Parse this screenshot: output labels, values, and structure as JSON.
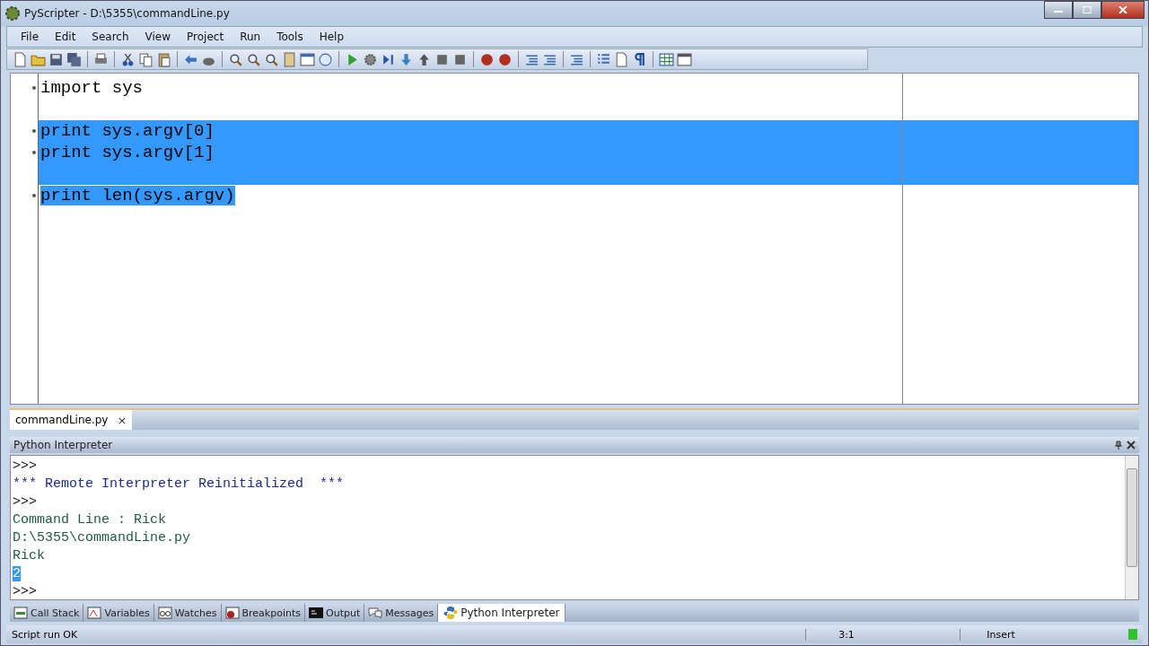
{
  "window": {
    "title": "PyScripter - D:\\5355\\commandLine.py"
  },
  "menu": [
    "File",
    "Edit",
    "Search",
    "View",
    "Project",
    "Run",
    "Tools",
    "Help"
  ],
  "editor": {
    "lines": [
      {
        "kind": "code",
        "text": "import sys",
        "selected": false
      },
      {
        "kind": "blank"
      },
      {
        "kind": "code",
        "text": "print sys.argv[0]",
        "selected": true
      },
      {
        "kind": "code",
        "text": "print sys.argv[1]",
        "selected": true
      },
      {
        "kind": "blank",
        "selected": true
      },
      {
        "kind": "code",
        "text": "print len(sys.argv)",
        "selected": true
      }
    ]
  },
  "editor_tabs": [
    {
      "label": "commandLine.py",
      "close": "×",
      "selected": true
    }
  ],
  "interpreter": {
    "title": "Python Interpreter",
    "lines": [
      {
        "kind": "prompt",
        "text": ">>>",
        "selected": false
      },
      {
        "kind": "info",
        "text": "*** Remote Interpreter Reinitialized  ***",
        "selected": false
      },
      {
        "kind": "prompt",
        "text": ">>>",
        "selected": false
      },
      {
        "kind": "output",
        "text": "Command Line : Rick",
        "selected": false
      },
      {
        "kind": "output",
        "text": "D:\\5355\\commandLine.py",
        "selected": false
      },
      {
        "kind": "output",
        "text": "Rick",
        "selected": false
      },
      {
        "kind": "output",
        "text": "2",
        "selected": true
      },
      {
        "kind": "prompt",
        "text": ">>>",
        "selected": false
      }
    ]
  },
  "bottom_tabs": [
    {
      "label": "Call Stack",
      "kind": "stack",
      "selected": false
    },
    {
      "label": "Variables",
      "kind": "vars",
      "selected": false
    },
    {
      "label": "Watches",
      "kind": "glasses",
      "selected": false
    },
    {
      "label": "Breakpoints",
      "kind": "breakpoint",
      "selected": false
    },
    {
      "label": "Output",
      "kind": "console",
      "selected": false
    },
    {
      "label": "Messages",
      "kind": "bubble",
      "selected": false
    },
    {
      "label": "Python Interpreter",
      "kind": "python",
      "selected": true
    }
  ],
  "status_bar": {
    "message": "Script run OK",
    "position": "3:1",
    "mode": "Insert"
  }
}
